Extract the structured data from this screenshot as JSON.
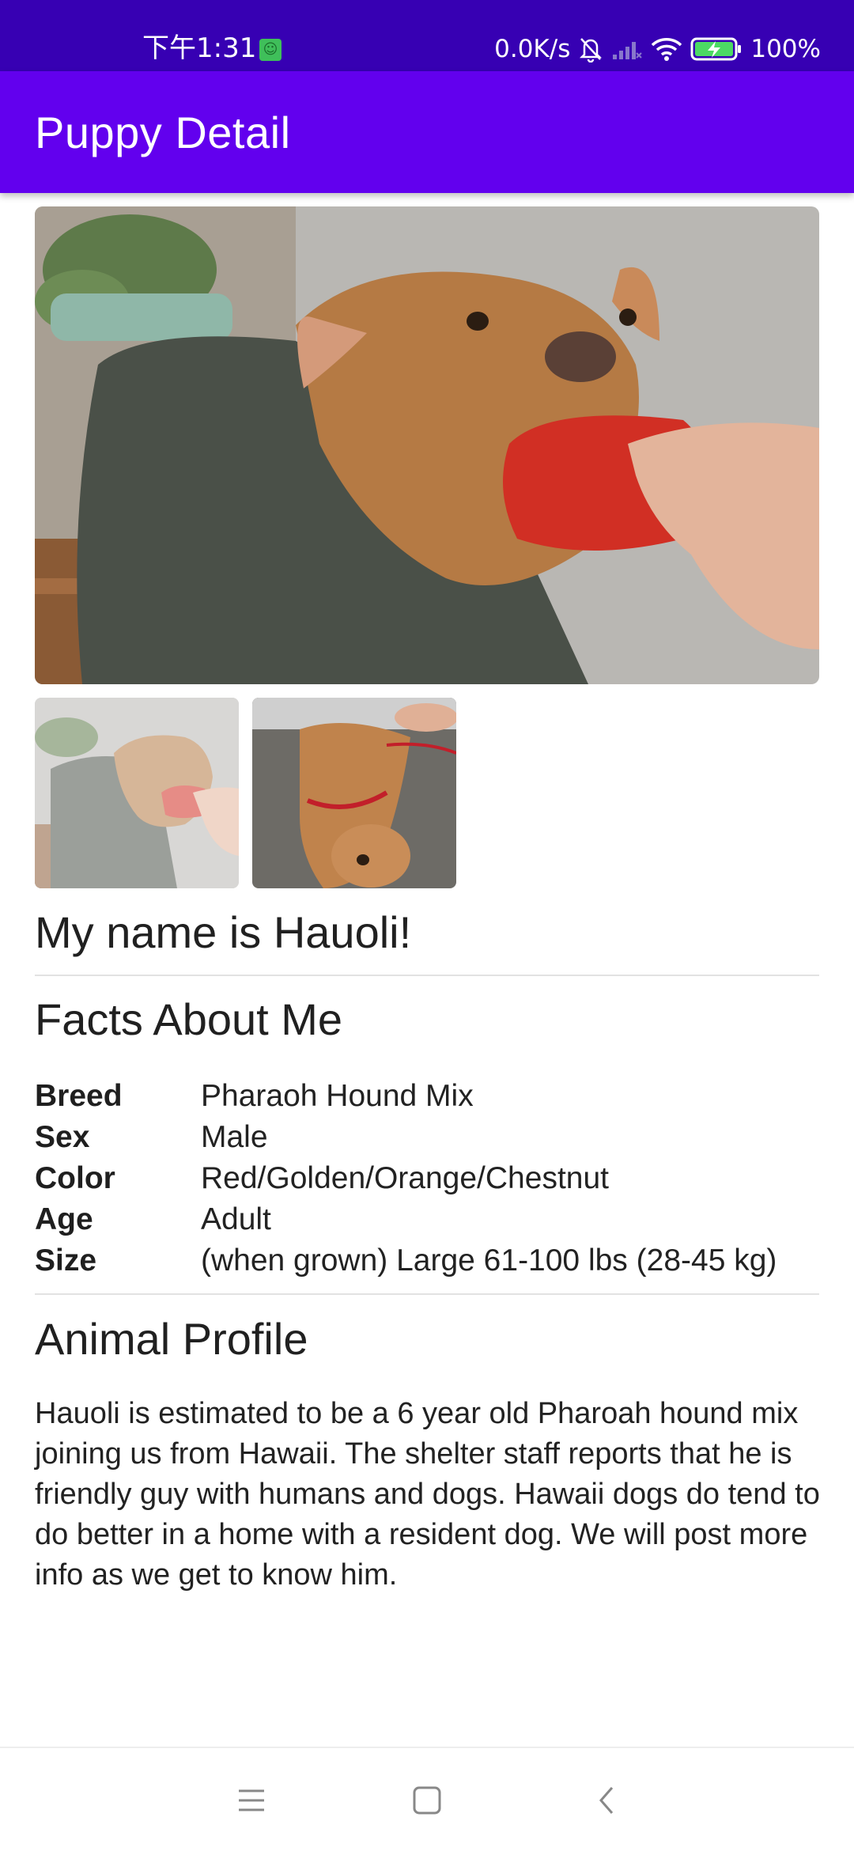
{
  "status_bar": {
    "time": "下午1:31",
    "network_speed": "0.0K/s",
    "battery": "100%",
    "icons": [
      "app-notification-icon",
      "mute-bell-icon",
      "signal-icon",
      "wifi-icon",
      "battery-charging-icon"
    ]
  },
  "app_bar": {
    "title": "Puppy Detail",
    "color": "#6200ee"
  },
  "gallery": {
    "main_photo": "dog-with-red-toy-photo",
    "thumbnails": [
      "dog-with-red-toy-thumbnail",
      "dog-lying-on-back-thumbnail"
    ]
  },
  "pet": {
    "name_heading": "My name is Hauoli!"
  },
  "facts": {
    "heading": "Facts About Me",
    "rows": [
      {
        "label": "Breed",
        "value": "Pharaoh Hound Mix"
      },
      {
        "label": "Sex",
        "value": "Male"
      },
      {
        "label": "Color",
        "value": "Red/Golden/Orange/Chestnut"
      },
      {
        "label": "Age",
        "value": "Adult"
      },
      {
        "label": "Size",
        "value": "(when grown) Large 61-100 lbs (28-45 kg)"
      }
    ]
  },
  "profile": {
    "heading": "Animal Profile",
    "text": "Hauoli is estimated to be a 6 year old  Pharoah hound mix joining us from Hawaii. The shelter staff reports that he is friendly guy with humans and dogs. Hawaii dogs do tend to do better in a  home with a resident dog. We will post more info as we get to know him."
  },
  "nav_bar": {
    "buttons": [
      "menu-icon",
      "home-icon",
      "back-icon"
    ]
  }
}
